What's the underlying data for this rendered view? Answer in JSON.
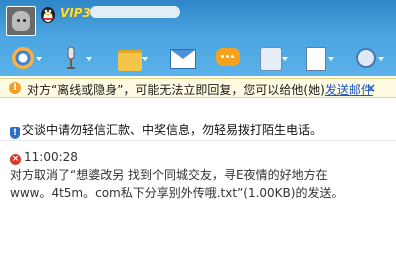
{
  "header": {
    "vip_label": "VIP3"
  },
  "toolbar": {
    "buttons": [
      {
        "icon": "video-icon"
      },
      {
        "icon": "voice-icon"
      },
      {
        "icon": "file-transfer-icon"
      },
      {
        "icon": "email-icon"
      },
      {
        "icon": "chat-bubble-icon"
      },
      {
        "icon": "speaker-icon"
      },
      {
        "icon": "game-cards-icon"
      },
      {
        "icon": "settings-icon"
      }
    ]
  },
  "notice": {
    "text": "对方“离线或隐身”，可能无法立即回复，您可以给他(她)",
    "link": "发送邮件",
    "close": "×"
  },
  "chat": {
    "security_text": "交谈中请勿轻信汇款、中奖信息，勿轻易拨打陌生电话。",
    "message": {
      "time": "11:00:28",
      "line1": "对方取消了“想婆改另   找到个同城交友，寻E夜情的好地方在",
      "line2": "www。4t5m。com私下分享别外传哦.txt”(1.00KB)的发送。"
    }
  },
  "colors": {
    "header_top": "#2f86c8",
    "header_bottom": "#5cb2ea",
    "notice_bg": "#fefbe2",
    "link": "#1a56c4",
    "error": "#d83a2a"
  }
}
